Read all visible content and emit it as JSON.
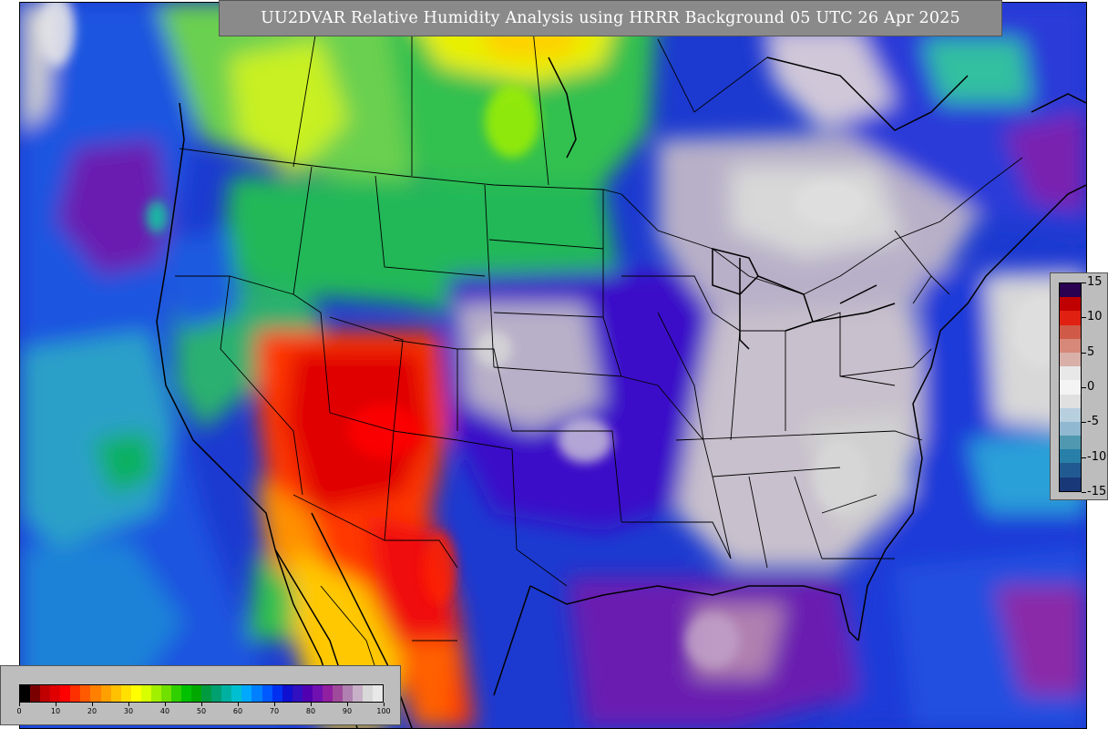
{
  "title": "UU2DVAR Relative Humidity Analysis using HRRR Background 05 UTC 26 Apr 2025",
  "map": {
    "projection": "Lambert conformal (CONUS)",
    "layer": "relative humidity",
    "boundaries": [
      "coastlines",
      "national borders",
      "state/province borders"
    ],
    "dominant_field": {
      "southwest": "red-orange (dry)",
      "northern-plains": "green-yellow",
      "east": "gray-purple-blue (moist)",
      "oceans": "blue-green-purple"
    }
  },
  "rh_legend": {
    "colors": [
      "#000000",
      "#7a0000",
      "#c00000",
      "#e00000",
      "#ff0000",
      "#ff3000",
      "#ff5a00",
      "#ff8000",
      "#ffa000",
      "#ffc000",
      "#ffe000",
      "#ffff00",
      "#d8ff00",
      "#a0f000",
      "#70e000",
      "#30d000",
      "#00c000",
      "#00a800",
      "#009a40",
      "#00a070",
      "#00b0a0",
      "#00c0d0",
      "#00a8ff",
      "#0080ff",
      "#0058ff",
      "#0030f0",
      "#1010d0",
      "#3010c0",
      "#5000b0",
      "#7010b0",
      "#9020a0",
      "#a04a9c",
      "#b080b0",
      "#c8b0c8",
      "#d8d8d8",
      "#e8e8e8"
    ],
    "ticks": [
      "0",
      "10",
      "20",
      "30",
      "40",
      "50",
      "60",
      "70",
      "80",
      "90",
      "100"
    ]
  },
  "increment_legend": {
    "colors": [
      "#2a0050",
      "#c00000",
      "#e02010",
      "#d05a48",
      "#d88878",
      "#d8b0a8",
      "#e8e8e8",
      "#f4f4f4",
      "#e0e0e0",
      "#b8cfe0",
      "#90b8d0",
      "#5098b0",
      "#2880a8",
      "#205a90",
      "#183878"
    ],
    "ticks": [
      "15",
      "10",
      "5",
      "0",
      "-5",
      "-10",
      "-15"
    ]
  }
}
